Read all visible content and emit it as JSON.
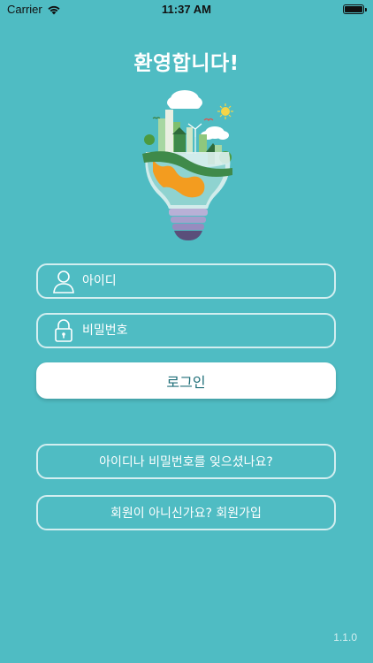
{
  "status_bar": {
    "carrier": "Carrier",
    "time": "11:37 AM",
    "wifi_icon": "wifi-icon",
    "battery_icon": "battery-icon",
    "battery_level": 1.0
  },
  "header": {
    "title": "환영합니다!"
  },
  "illustration": {
    "icon": "eco-city-lightbulb-illustration"
  },
  "login_form": {
    "id_field": {
      "placeholder": "아이디",
      "value": "",
      "icon": "user-silhouette-icon"
    },
    "password_field": {
      "placeholder": "비밀번호",
      "value": "",
      "icon": "lock-icon"
    },
    "login_label": "로그인"
  },
  "links": {
    "forgot_label": "아이디나 비밀번호를 잊으셨나요?",
    "signup_label": "회원이 아니신가요? 회원가입"
  },
  "footer": {
    "version": "1.1.0"
  },
  "colors": {
    "background": "#4fbcc3",
    "login_text": "#1f6e78",
    "border": "#ffffff"
  }
}
